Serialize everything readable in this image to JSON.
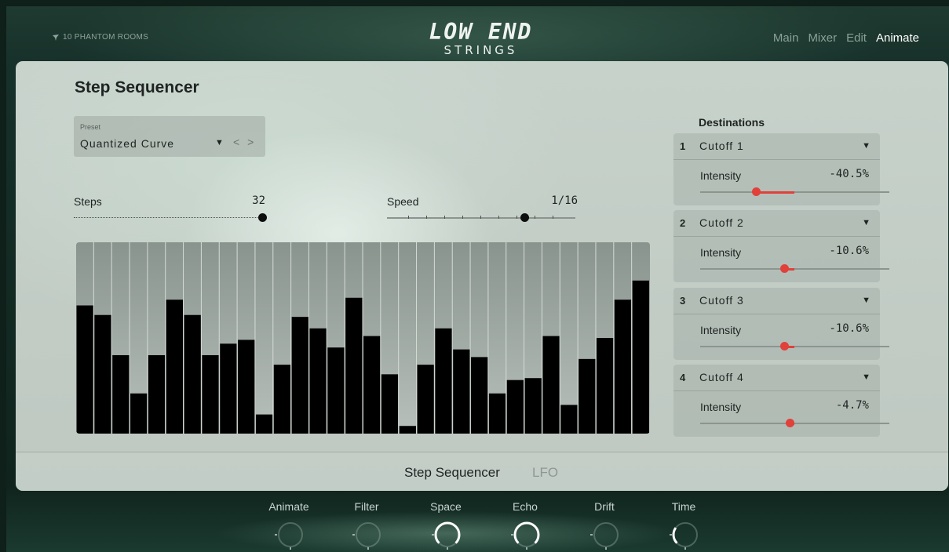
{
  "header": {
    "brand": "10 PHANTOM ROOMS",
    "logo_line1": "LOW END",
    "logo_line2": "STRINGS",
    "nav": [
      {
        "label": "Main",
        "active": false
      },
      {
        "label": "Mixer",
        "active": false
      },
      {
        "label": "Edit",
        "active": false
      },
      {
        "label": "Animate",
        "active": true
      }
    ]
  },
  "panel": {
    "title": "Step Sequencer",
    "preset": {
      "label": "Preset",
      "value": "Quantized Curve",
      "dropdown_icon": "triangle-down",
      "arrows": "< >"
    },
    "steps": {
      "label": "Steps",
      "value": "32",
      "level": 1.0
    },
    "speed": {
      "label": "Speed",
      "value": "1/16",
      "level": 0.73
    },
    "sequence": [
      0.67,
      0.62,
      0.41,
      0.21,
      0.41,
      0.7,
      0.62,
      0.41,
      0.47,
      0.49,
      0.1,
      0.36,
      0.61,
      0.55,
      0.45,
      0.71,
      0.51,
      0.31,
      0.04,
      0.36,
      0.55,
      0.44,
      0.4,
      0.21,
      0.28,
      0.29,
      0.51,
      0.15,
      0.39,
      0.5,
      0.7,
      0.8
    ],
    "destinations_title": "Destinations",
    "destinations": [
      {
        "num": "1",
        "name": "Cutoff 1",
        "intensity_label": "Intensity",
        "intensity": "-40.5%",
        "amount": -0.405
      },
      {
        "num": "2",
        "name": "Cutoff 2",
        "intensity_label": "Intensity",
        "intensity": "-10.6%",
        "amount": -0.106
      },
      {
        "num": "3",
        "name": "Cutoff 3",
        "intensity_label": "Intensity",
        "intensity": "-10.6%",
        "amount": -0.106
      },
      {
        "num": "4",
        "name": "Cutoff 4",
        "intensity_label": "Intensity",
        "intensity": "-4.7%",
        "amount": -0.047
      }
    ],
    "tabs": [
      {
        "label": "Step Sequencer",
        "active": true
      },
      {
        "label": "LFO",
        "active": false
      }
    ]
  },
  "macros": [
    {
      "label": "Animate",
      "level": 0.0
    },
    {
      "label": "Filter",
      "level": 0.0
    },
    {
      "label": "Space",
      "level": 1.0
    },
    {
      "label": "Echo",
      "level": 1.0
    },
    {
      "label": "Drift",
      "level": 0.0
    },
    {
      "label": "Time",
      "level": 0.3
    }
  ],
  "colors": {
    "accent": "#e0413a",
    "panel": "#c4cec7",
    "bar": "#000000",
    "active_nav": "#ffffff"
  }
}
